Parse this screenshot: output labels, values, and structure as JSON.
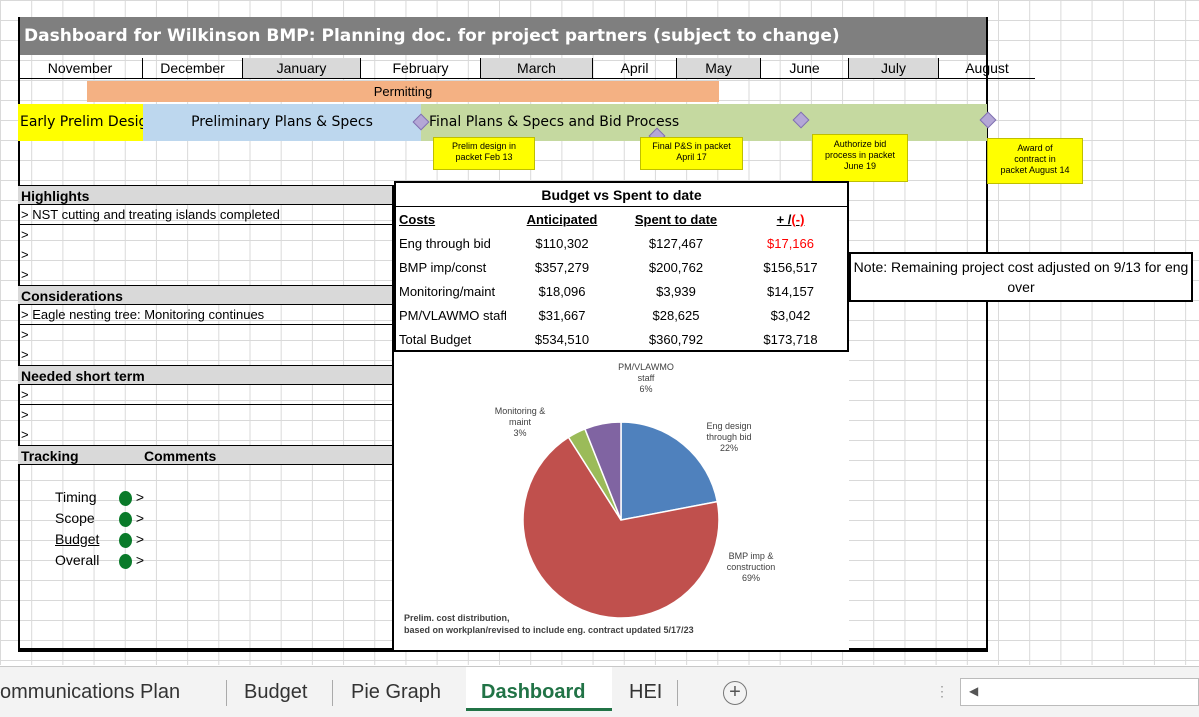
{
  "title": "Dashboard for Wilkinson BMP: Planning doc. for project partners (subject to change)",
  "months": [
    "November",
    "December",
    "January",
    "February",
    "March",
    "April",
    "May",
    "June",
    "July",
    "August"
  ],
  "permitting": "Permitting",
  "phases": {
    "early": "Early Prelim Design",
    "prelim": "Preliminary Plans & Specs",
    "final": "Final Plans & Specs and Bid Process"
  },
  "notes": {
    "n1": [
      "Prelim design in",
      "packet Feb 13"
    ],
    "n2": [
      "Final P&S in packet",
      "April 17"
    ],
    "n3": [
      "Authorize bid",
      "process in packet",
      "June 19"
    ],
    "n4": [
      "Award of",
      "contract in",
      "packet August 14"
    ]
  },
  "highlights": {
    "header": "Highlights",
    "items": [
      "> NST cutting and treating islands completed",
      ">",
      ">",
      ">"
    ]
  },
  "considerations": {
    "header": "Considerations",
    "items": [
      "> Eagle nesting tree: Monitoring continues",
      ">",
      ">"
    ]
  },
  "needed": {
    "header": "Needed short term",
    "items": [
      ">",
      ">",
      ">"
    ]
  },
  "tracking": {
    "header": "Tracking",
    "comments": "Comments",
    "rows": [
      {
        "label": "Timing",
        "comment": ">"
      },
      {
        "label": "Scope",
        "comment": ">"
      },
      {
        "label": "Budget",
        "comment": ">"
      },
      {
        "label": "Overall",
        "comment": ">"
      }
    ],
    "status_color": "#0a7a2a"
  },
  "budget": {
    "header": "Budget vs Spent to date",
    "columns": [
      "Costs",
      "Anticipated",
      "Spent to date",
      "+ /(-)"
    ],
    "rows": [
      [
        "Eng through bid",
        "$110,302",
        "$127,467",
        "$17,166"
      ],
      [
        "BMP imp/const",
        "$357,279",
        "$200,762",
        "$156,517"
      ],
      [
        "Monitoring/maint",
        "$18,096",
        "$3,939",
        "$14,157"
      ],
      [
        "PM/VLAWMO staff",
        "$31,667",
        "$28,625",
        "$3,042"
      ],
      [
        "Total Budget",
        "$534,510",
        "$360,792",
        "$173,718"
      ]
    ],
    "negative_color": "#ff0000"
  },
  "note_box": "Note: Remaining project cost adjusted on 9/13 for eng over",
  "chart_data": {
    "type": "pie",
    "slices": [
      {
        "label": "Eng design through bid",
        "value": 22,
        "color": "#4f81bd"
      },
      {
        "label": "BMP imp & construction",
        "value": 69,
        "color": "#c0504d"
      },
      {
        "label": "Monitoring & maint",
        "value": 3,
        "color": "#9bbb59"
      },
      {
        "label": "PM/VLAWMO staff",
        "value": 6,
        "color": "#8064a2"
      }
    ],
    "caption": [
      "Prelim. cost distribution,",
      "based on workplan/revised to include eng. contract updated 5/17/23"
    ]
  },
  "sheet_tabs": [
    "ommunications Plan",
    "Budget",
    "Pie Graph",
    "Dashboard",
    "HEI"
  ],
  "active_tab": "Dashboard"
}
